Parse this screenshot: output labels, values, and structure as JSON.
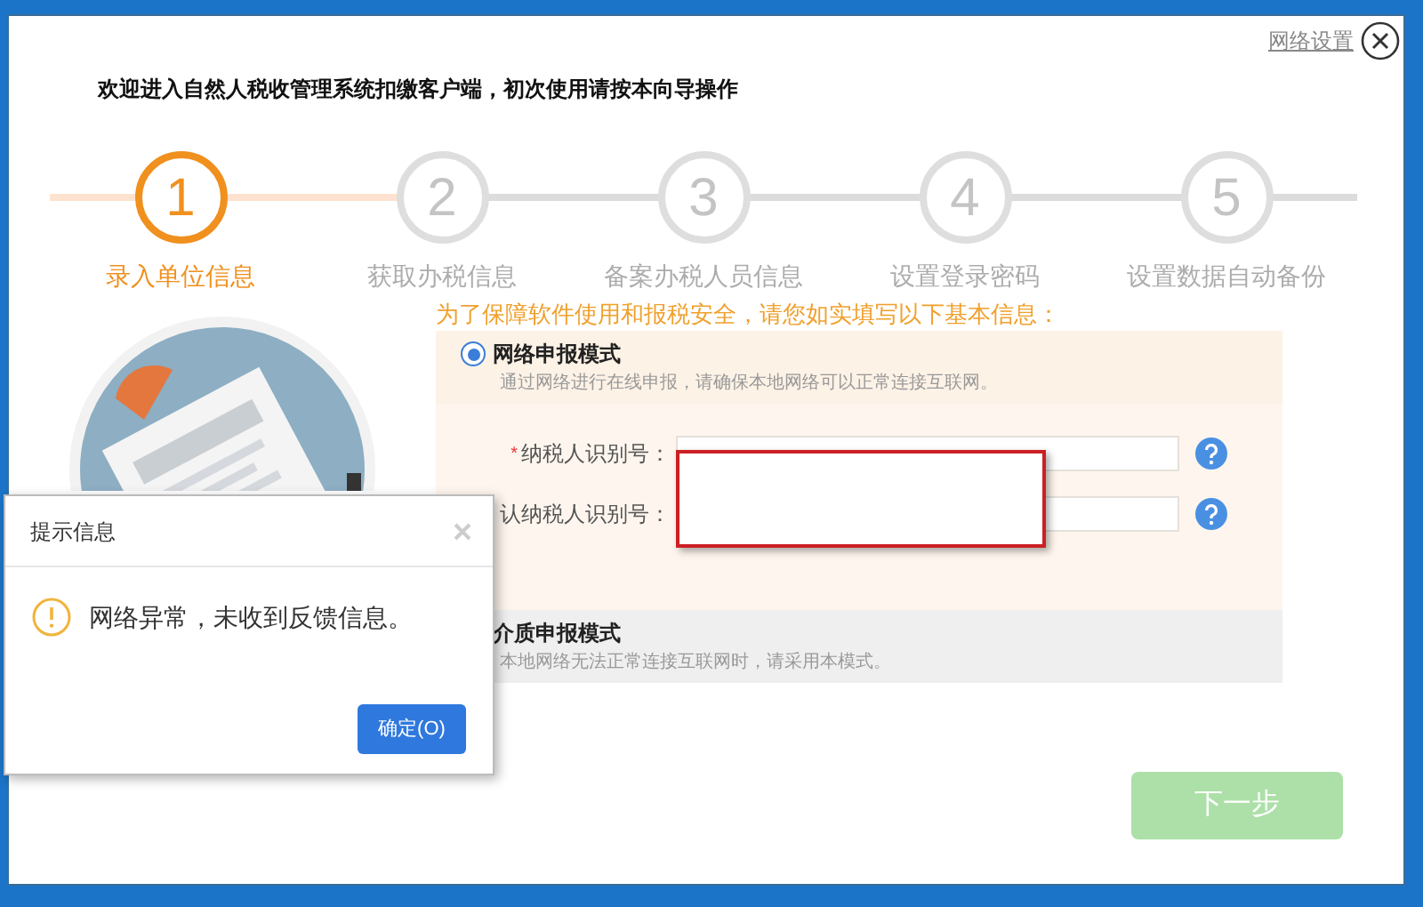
{
  "window": {
    "network_settings_link": "网络设置",
    "heading": "欢迎进入自然人税收管理系统扣缴客户端，初次使用请按本向导操作"
  },
  "steps": [
    {
      "number": "1",
      "label": "录入单位信息",
      "selected": true
    },
    {
      "number": "2",
      "label": "获取办税信息",
      "selected": false
    },
    {
      "number": "3",
      "label": "备案办税人员信息",
      "selected": false
    },
    {
      "number": "4",
      "label": "设置登录密码",
      "selected": false
    },
    {
      "number": "5",
      "label": "设置数据自动备份",
      "selected": false
    }
  ],
  "notice": "为了保障软件使用和报税安全，请您如实填写以下基本信息：",
  "modes": [
    {
      "title": "网络申报模式",
      "description": "通过网络进行在线申报，请确保本地网络可以正常连接互联网。",
      "selected": true
    },
    {
      "title": "介质申报模式",
      "description": "本地网络无法正常连接互联网时，请采用本模式。",
      "selected": false
    }
  ],
  "fields": [
    {
      "marker": "*",
      "label": "纳税人识别号："
    },
    {
      "label": "认纳税人识别号："
    }
  ],
  "next_button": {
    "label": "下一步",
    "disabled": true
  },
  "dialog": {
    "title": "提示信息",
    "message": "网络异常，未收到反馈信息。",
    "button": "确定(O)"
  }
}
